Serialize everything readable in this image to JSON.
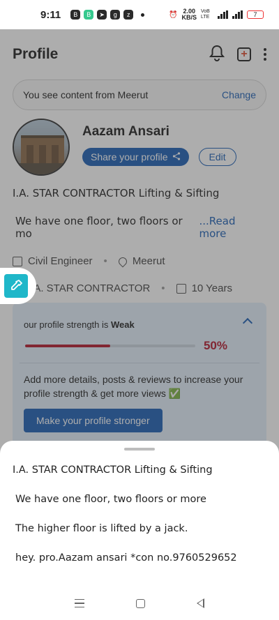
{
  "status_bar": {
    "time": "9:11",
    "speed_top": "2.00",
    "speed_bottom": "KB/S",
    "network": "VoB LTE",
    "net_type": "4G",
    "battery": "7"
  },
  "header": {
    "title": "Profile",
    "icons": [
      "bell-icon",
      "add-post-icon",
      "more-menu-icon"
    ]
  },
  "location_bar": {
    "text": "You see content from Meerut",
    "action": "Change"
  },
  "profile": {
    "name": "Aazam Ansari",
    "share_label": "Share your profile",
    "edit_label": "Edit",
    "headline": "I.A.  STAR CONTRACTOR Lifting & Sifting",
    "about_short": "We have one floor, two floors or mo",
    "read_more": "...Read more",
    "profession": "Civil Engineer",
    "city": "Meerut",
    "company": "I.A.  STAR CONTRACTOR",
    "experience": "10 Years"
  },
  "strength_card": {
    "title_prefix": "our profile strength is ",
    "level": "Weak",
    "percent_text": "50%",
    "percent": 0.5,
    "tip": "Add more details, posts & reviews to increase your profile strength & get more views ✅",
    "button": "Make your profile stronger"
  },
  "sheet": {
    "lines": [
      "I.A.  STAR CONTRACTOR Lifting & Sifting",
      "We have one floor, two floors or more",
      "The higher floor is lifted by a jack.",
      "hey.  pro.Aazam ansari *con no.9760529652"
    ]
  },
  "colors": {
    "accent": "#1c5fb5",
    "weak": "#b3172c",
    "card_bg": "#e4f0fb",
    "picker": "#1fb7c9"
  }
}
